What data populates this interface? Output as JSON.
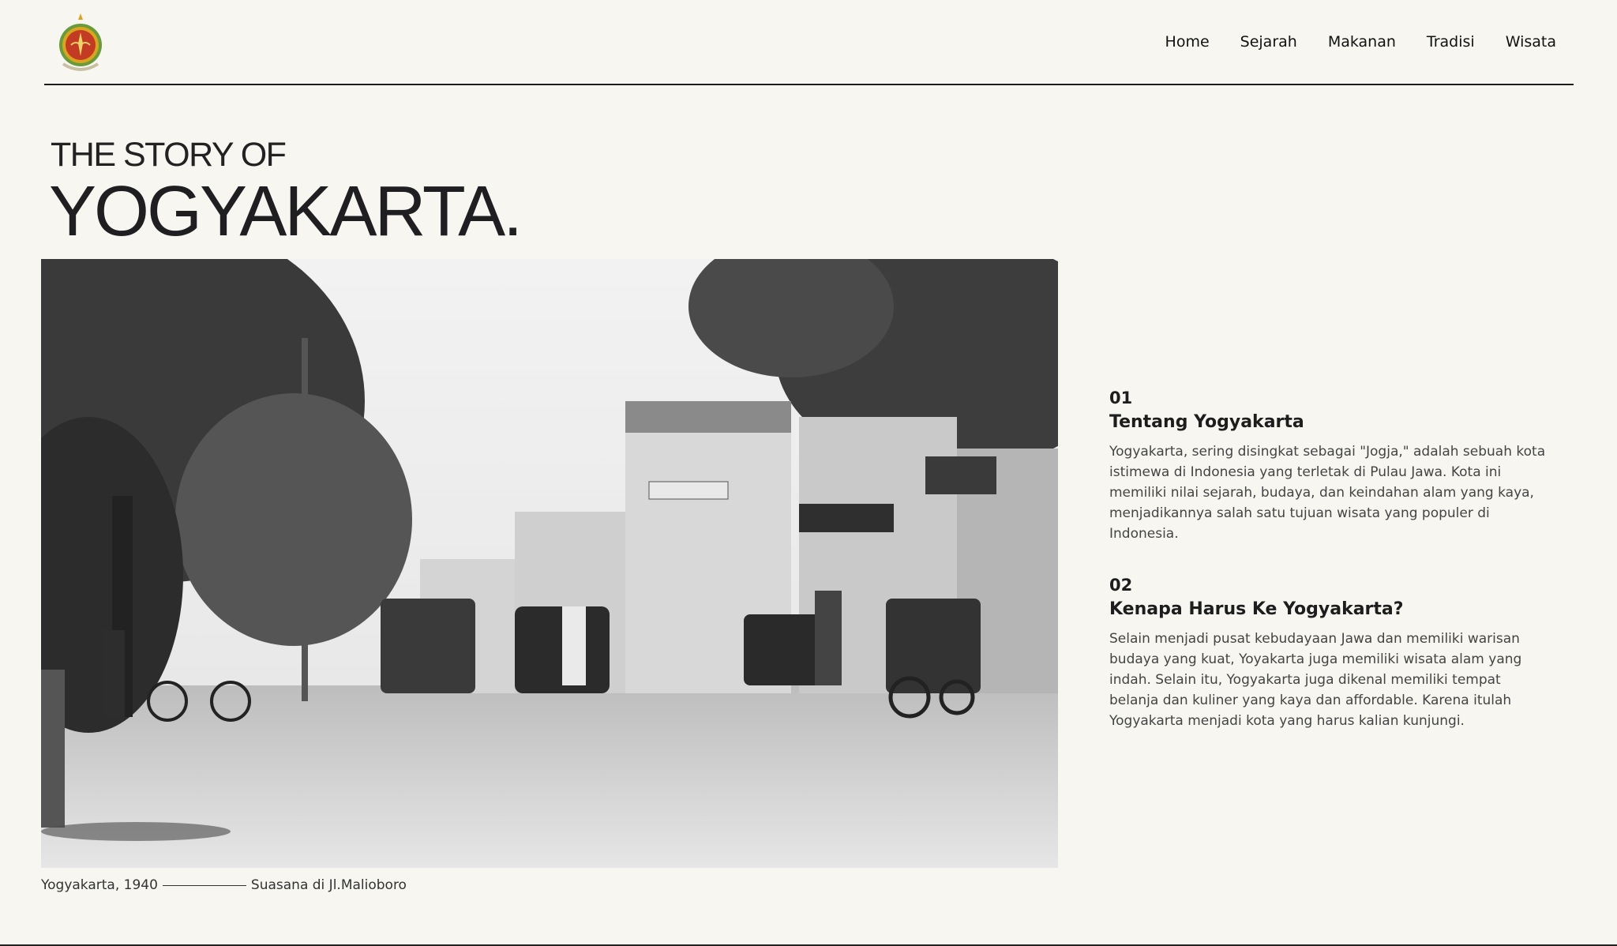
{
  "nav": {
    "items": [
      "Home",
      "Sejarah",
      "Makanan",
      "Tradisi",
      "Wisata"
    ]
  },
  "hero": {
    "line1": "THE STORY OF",
    "line2": "YOGYAKARTA."
  },
  "caption": {
    "left": "Yogyakarta, 1940",
    "right": "Suasana di Jl.Malioboro"
  },
  "sections": [
    {
      "number": "01",
      "title": "Tentang Yogyakarta",
      "body": "Yogyakarta, sering disingkat sebagai \"Jogja,\" adalah sebuah kota istimewa di Indonesia yang terletak di Pulau Jawa. Kota ini memiliki nilai sejarah, budaya, dan keindahan alam yang kaya, menjadikannya salah satu tujuan wisata yang populer di Indonesia."
    },
    {
      "number": "02",
      "title": "Kenapa Harus Ke Yogyakarta?",
      "body": "Selain menjadi pusat kebudayaan Jawa dan memiliki warisan budaya yang kuat, Yoyakarta juga memiliki wisata alam yang indah. Selain itu, Yogyakarta juga dikenal memiliki tempat belanja dan kuliner yang kaya dan affordable. Karena itulah Yogyakarta menjadi kota yang harus kalian kunjungi."
    }
  ],
  "colors": {
    "background": "#f7f6f1",
    "text": "#222222",
    "logo_red": "#c23b22",
    "logo_gold": "#d9a520"
  },
  "icons": {
    "logo": "yogyakarta-crest-icon"
  }
}
